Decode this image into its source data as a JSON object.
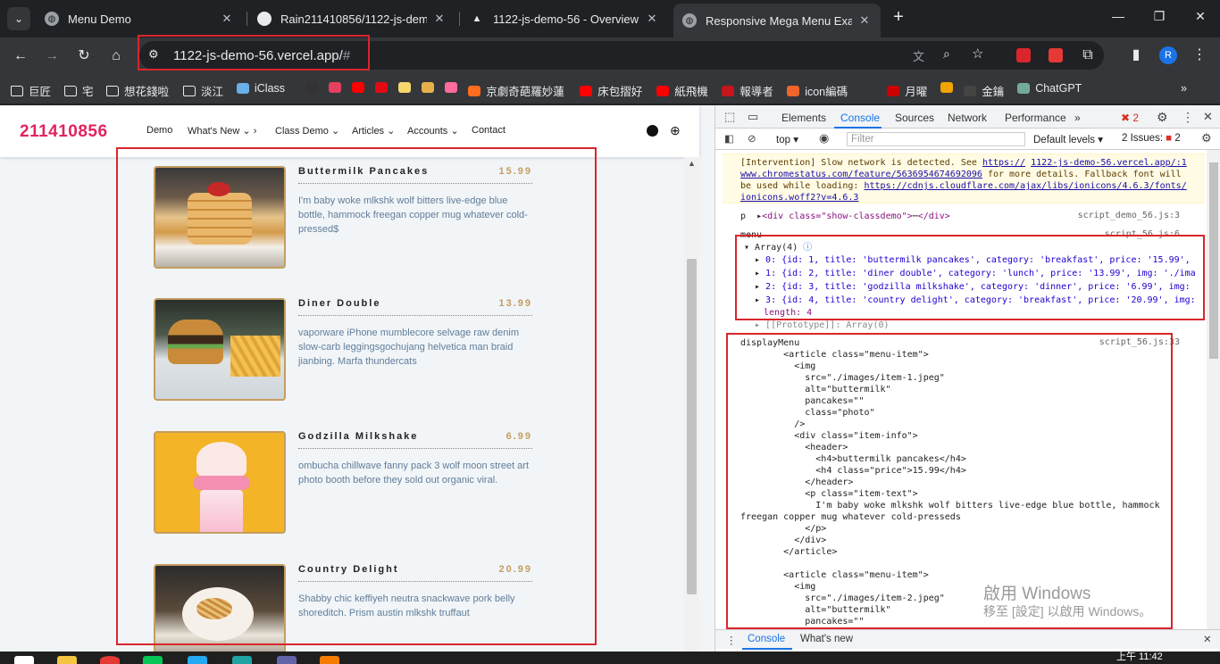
{
  "browser": {
    "tabs": [
      {
        "title": "Menu Demo",
        "icon": "globe-icon"
      },
      {
        "title": "Rain211410856/1122-js-demo",
        "icon": "github-icon"
      },
      {
        "title": "1122-js-demo-56 - Overview",
        "icon": "vercel-icon"
      },
      {
        "title": "Responsive Mega Menu Exam",
        "icon": "globe-icon"
      }
    ],
    "new_tab": "+",
    "url": "1122-js-demo-56.vercel.app/",
    "url_hash": "#",
    "profile_initial": "R"
  },
  "bookmarks": [
    {
      "label": "巨匠",
      "type": "folder"
    },
    {
      "label": "宅",
      "type": "folder"
    },
    {
      "label": "想花錢啦",
      "type": "folder"
    },
    {
      "label": "淡江",
      "type": "folder"
    },
    {
      "label": "iClass",
      "type": "site",
      "color": "#6ab0e8"
    },
    {
      "label": "",
      "type": "site",
      "color": "#333"
    },
    {
      "label": "",
      "type": "site",
      "color": "#e4405f"
    },
    {
      "label": "",
      "type": "site",
      "color": "#ff0000"
    },
    {
      "label": "",
      "type": "site",
      "color": "#e50914"
    },
    {
      "label": "",
      "type": "site",
      "color": "#f5d76e"
    },
    {
      "label": "",
      "type": "site",
      "color": "#e8b04a"
    },
    {
      "label": "",
      "type": "site",
      "color": "#ff6b9a"
    },
    {
      "label": "京劇奇葩羅妙蓮",
      "type": "site",
      "color": "#ff6d1f"
    },
    {
      "label": "床包摺好",
      "type": "site",
      "color": "#ff0000"
    },
    {
      "label": "紙飛機",
      "type": "site",
      "color": "#ff0000"
    },
    {
      "label": "報導者",
      "type": "site",
      "color": "#c4161c"
    },
    {
      "label": "icon編碼",
      "type": "site",
      "color": "#f06529"
    },
    {
      "label": "月曜",
      "type": "site",
      "color": "#c00"
    },
    {
      "label": "",
      "type": "site",
      "color": "#f0a500"
    },
    {
      "label": "金鑰",
      "type": "site",
      "color": "#444"
    },
    {
      "label": "ChatGPT",
      "type": "site",
      "color": "#74aa9c"
    }
  ],
  "site": {
    "brand": "211410856",
    "nav": [
      "Demo",
      "What's New",
      "Class Demo",
      "Articles",
      "Accounts",
      "Contact"
    ],
    "items": [
      {
        "title": "Buttermilk Pancakes",
        "price": "15.99",
        "text": "I'm baby woke mlkshk wolf bitters live-edge blue bottle, hammock freegan copper mug whatever cold-pressed$",
        "photo": "pancakes-photo"
      },
      {
        "title": "Diner Double",
        "price": "13.99",
        "text": "vaporware iPhone mumblecore selvage raw denim slow-carb leggingsgochujang helvetica man braid jianbing. Marfa thundercats",
        "photo": "burger-photo"
      },
      {
        "title": "Godzilla Milkshake",
        "price": "6.99",
        "text": "ombucha chillwave fanny pack 3 wolf moon street art photo booth before they sold out organic viral.",
        "photo": "milkshake-photo"
      },
      {
        "title": "Country Delight",
        "price": "20.99",
        "text": "Shabby chic keffiyeh neutra snackwave pork belly shoreditch. Prism austin mlkshk truffaut",
        "photo": "breakfast-photo"
      }
    ]
  },
  "devtools": {
    "tabs": [
      "Elements",
      "Console",
      "Sources",
      "Network",
      "Performance",
      "»"
    ],
    "error_count": "2",
    "context": "top",
    "filter_placeholder": "Filter",
    "levels": "Default levels",
    "issues_label": "2 Issues:",
    "issues_count": "2",
    "warning": {
      "l1a": "[Intervention] Slow network is detected. See ",
      "l1b": "https://",
      "l1c": "1122-js-demo-56.vercel.app/:1",
      "l2a": "www.chromestatus.com/feature/5636954674692096",
      "l2b": " for more details. Fallback font will",
      "l3a": "be used while loading: ",
      "l3b": "https://cdnjs.cloudflare.com/ajax/libs/ionicons/4.6.3/fonts/",
      "l4": "ionicons.woff2?v=4.6.3"
    },
    "log_p": "p",
    "log_p_div": "<div class=\"show-classdemo\">",
    "log_p_ellipsis": "⋯",
    "log_p_close": "</div>",
    "src_1": "script_demo_56.js:3",
    "menu_label": "menu",
    "src_2": "script_56.js:6",
    "array_label": "Array(4)",
    "array_rows": [
      "0: {id: 1, title: 'buttermilk pancakes', category: 'breakfast', price: '15.99',",
      "1: {id: 2, title: 'diner double', category: 'lunch', price: '13.99', img: './ima",
      "2: {id: 3, title: 'godzilla milkshake', category: 'dinner', price: '6.99', img:",
      "3: {id: 4, title: 'country delight', category: 'breakfast', price: '20.99', img:"
    ],
    "length_row": "length: 4",
    "proto_row": "[[Prototype]]: Array(0)",
    "display_label": "displayMenu",
    "src_3": "script_56.js:33",
    "code_lines": [
      "        <article class=\"menu-item\">",
      "          <img",
      "            src=\"./images/item-1.jpeg\"",
      "            alt=\"buttermilk\"",
      "            pancakes=\"\"",
      "            class=\"photo\"",
      "          />",
      "          <div class=\"item-info\">",
      "            <header>",
      "              <h4>buttermilk pancakes</h4>",
      "              <h4 class=\"price\">15.99</h4>",
      "            </header>",
      "            <p class=\"item-text\">",
      "              I'm baby woke mlkshk wolf bitters live-edge blue bottle, hammock",
      "freegan copper mug whatever cold-presseds",
      "            </p>",
      "          </div>",
      "        </article>",
      "",
      "        <article class=\"menu-item\">",
      "          <img",
      "            src=\"./images/item-2.jpeg\"",
      "            alt=\"buttermilk\"",
      "            pancakes=\"\""
    ],
    "drawer_tabs": [
      "Console",
      "What's new"
    ]
  },
  "watermark": {
    "line1": "啟用 Windows",
    "line2": "移至 [設定] 以啟用 Windows。"
  },
  "taskbar": {
    "clock": "上午 11:42"
  }
}
